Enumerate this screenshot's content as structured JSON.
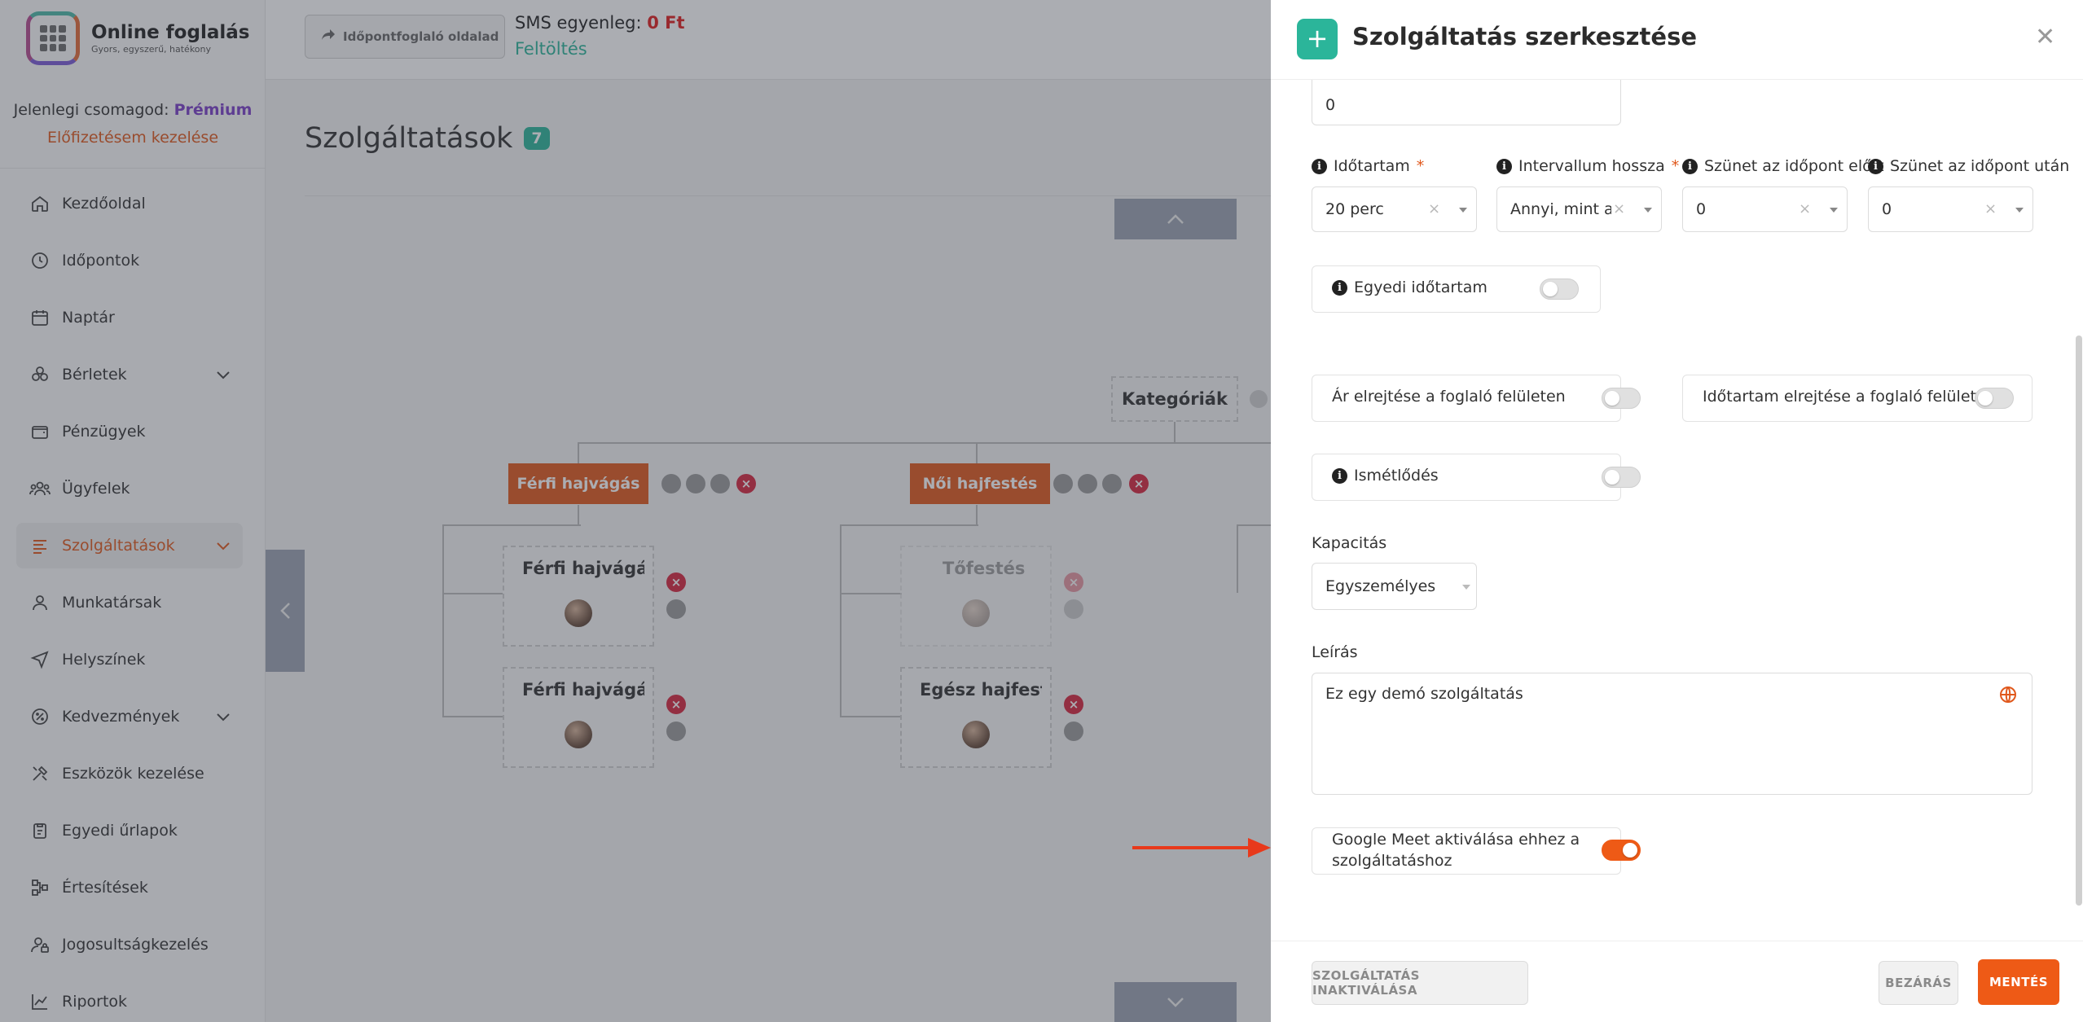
{
  "app": {
    "brand_title": "Online foglalás",
    "brand_tagline": "Gyors, egyszerű, hatékony"
  },
  "package": {
    "label": "Jelenlegi csomagod:",
    "name": "Prémium",
    "manage_link": "Előfizetésem kezelése"
  },
  "sidebar": {
    "items": [
      {
        "label": "Kezdőoldal",
        "icon": "home-icon"
      },
      {
        "label": "Időpontok",
        "icon": "clock-icon"
      },
      {
        "label": "Naptár",
        "icon": "calendar-icon"
      },
      {
        "label": "Bérletek",
        "icon": "tickets-icon",
        "expandable": true
      },
      {
        "label": "Pénzügyek",
        "icon": "wallet-icon"
      },
      {
        "label": "Ügyfelek",
        "icon": "users-icon"
      },
      {
        "label": "Szolgáltatások",
        "icon": "list-icon",
        "expandable": true,
        "active": true
      },
      {
        "label": "Munkatársak",
        "icon": "person-icon"
      },
      {
        "label": "Helyszínek",
        "icon": "location-arrow-icon"
      },
      {
        "label": "Kedvezmények",
        "icon": "discount-icon",
        "expandable": true
      },
      {
        "label": "Eszközök kezelése",
        "icon": "tools-icon"
      },
      {
        "label": "Egyedi űrlapok",
        "icon": "clipboard-icon"
      },
      {
        "label": "Értesítések",
        "icon": "network-icon"
      },
      {
        "label": "Jogosultságkezelés",
        "icon": "user-lock-icon"
      },
      {
        "label": "Riportok",
        "icon": "chart-icon"
      }
    ]
  },
  "topbar": {
    "booking_page_button": "Időpontfoglaló oldalad",
    "sms_label": "SMS egyenleg:",
    "sms_balance": "0 Ft",
    "topup_link": "Feltöltés"
  },
  "main": {
    "title": "Szolgáltatások",
    "count": "7",
    "root_category": "Kategóriák",
    "categories": [
      {
        "name": "Férfi hajvágás"
      },
      {
        "name": "Női hajfestés"
      }
    ],
    "services": [
      {
        "name": "Férfi hajvágás"
      },
      {
        "name": "Férfi hajvágás"
      },
      {
        "name": "Tőfestés"
      },
      {
        "name": "Egész hajfestés"
      }
    ]
  },
  "panel": {
    "title": "Szolgáltatás szerkesztése",
    "price_value": "0",
    "duration": {
      "label": "Időtartam",
      "value": "20 perc"
    },
    "interval": {
      "label": "Intervallum hossza",
      "value": "Annyi, mint a..."
    },
    "break_before": {
      "label": "Szünet az időpont előtt",
      "value": "0"
    },
    "break_after": {
      "label": "Szünet az időpont után",
      "value": "0"
    },
    "custom_duration": {
      "label": "Egyedi időtartam",
      "on": false
    },
    "hide_price": {
      "label": "Ár elrejtése a foglaló felületen",
      "on": false
    },
    "hide_duration": {
      "label": "Időtartam elrejtése a foglaló felületen",
      "on": false
    },
    "repeat": {
      "label": "Ismétlődés",
      "on": false
    },
    "capacity": {
      "label": "Kapacitás",
      "value": "Egyszemélyes"
    },
    "description": {
      "label": "Leírás",
      "value": "Ez egy demó szolgáltatás"
    },
    "google_meet": {
      "line1": "Google Meet aktiválása ehhez a",
      "line2": "szolgáltatáshoz",
      "on": true
    },
    "buttons": {
      "deactivate": "SZOLGÁLTATÁS INAKTIVÁLÁSA",
      "close": "BEZÁRÁS",
      "save": "MENTÉS"
    }
  },
  "colors": {
    "accent_orange": "#ee5a16",
    "accent_teal": "#2bb59a",
    "premium_purple": "#7a3fc8",
    "annotation_arrow": "#e8391b"
  }
}
